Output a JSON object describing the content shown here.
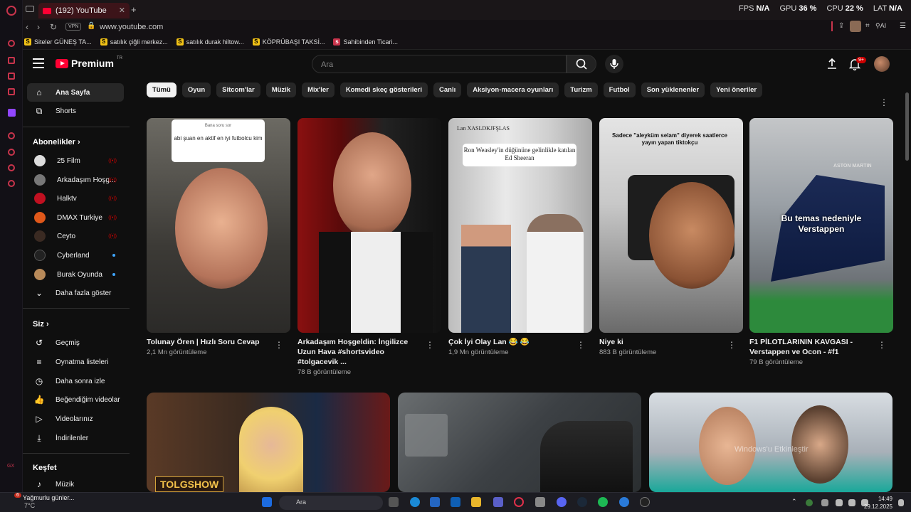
{
  "browser": {
    "tab_title": "(192) YouTube",
    "new_tab": "+",
    "url": "www.youtube.com",
    "vpn": "VPN",
    "stats": {
      "fps_label": "FPS",
      "fps_value": "N/A",
      "gpu_label": "GPU",
      "gpu_value": "36 %",
      "cpu_label": "CPU",
      "cpu_value": "22 %",
      "lat_label": "LAT",
      "lat_value": "N/A"
    },
    "bookmarks": [
      "Siteler GÜNEŞ TA...",
      "satılık çiğli merkez...",
      "satılık durak hiltow...",
      "KÖPRÜBAŞI TAKSİ...",
      "Sahibinden Ticari..."
    ],
    "ai_label": "AI"
  },
  "youtube": {
    "logo_text": "Premium",
    "logo_region": "TR",
    "search_placeholder": "Ara",
    "notif_badge": "9+",
    "chips": [
      "Tümü",
      "Oyun",
      "Sitcom'lar",
      "Müzik",
      "Mix'ler",
      "Komedi skeç gösterileri",
      "Canlı",
      "Aksiyon-macera oyunları",
      "Turizm",
      "Futbol",
      "Son yüklenenler",
      "Yeni öneriler"
    ],
    "sidebar": {
      "home": "Ana Sayfa",
      "shorts": "Shorts",
      "subs_header": "Abonelikler",
      "subs": [
        "25 Film",
        "Arkadaşım Hoşg...",
        "Halktv",
        "DMAX Turkiye",
        "Ceyto",
        "Cyberland",
        "Burak Oyunda"
      ],
      "show_more": "Daha fazla göster",
      "you_header": "Siz",
      "you_items": [
        "Geçmiş",
        "Oynatma listeleri",
        "Daha sonra izle",
        "Beğendiğim videolar",
        "Videolarınız",
        "İndirilenler"
      ],
      "explore_header": "Keşfet",
      "explore_items": [
        "Müzik"
      ]
    },
    "shorts": [
      {
        "title": "Tolunay Ören | Hızlı Soru Cevap",
        "views": "2,1 Mn görüntüleme",
        "overlay_small": "Bana soru sor",
        "overlay": "abi şuan en aktif en iyi futbolcu kim"
      },
      {
        "title": "Arkadaşım Hoşgeldin: İngilizce Uzun Hava  #shortsvideo #tolgacevik ...",
        "views": "78 B görüntüleme"
      },
      {
        "title": "Çok İyi Olay Lan 😂 😂",
        "views": "1,9 Mn görüntüleme",
        "overlay_top": "Lan XASLDKJFŞLAS",
        "overlay": "Ron Weasley'in düğününe gelinlikle katılan Ed Sheeran"
      },
      {
        "title": "Niye ki",
        "views": "883 B görüntüleme",
        "overlay": "Sadece \"aleyküm selam\" diyerek saatlerce yayın yapan tiktokçu"
      },
      {
        "title": "F1 PİLOTLARININ KAVGASI - Verstappen ve Ocon - #f1",
        "views": "79 B görüntüleme",
        "overlay": "Bu temas nedeniyle Verstappen",
        "car_text": "ASTON MARTIN"
      }
    ],
    "video_overlay": "TOLGSHOW",
    "activation_watermark": "Windows'u Etkinleştir"
  },
  "taskbar": {
    "weather_title": "Yağmurlu günler...",
    "weather_temp": "7°C",
    "weather_badge": "6",
    "search": "Ara",
    "time": "14:49",
    "date": "29.12.2025"
  }
}
